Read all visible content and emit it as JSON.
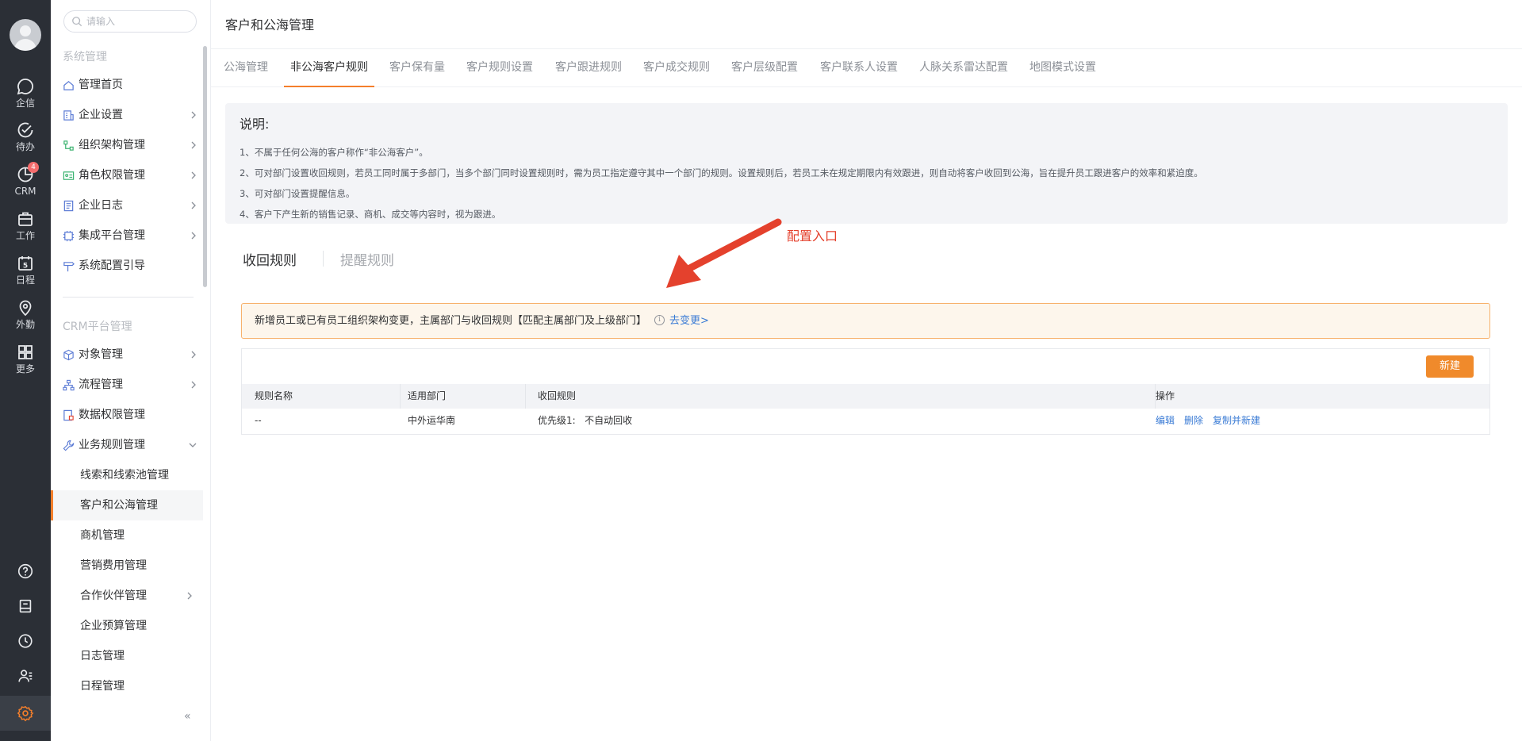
{
  "rail": {
    "items": [
      {
        "label": "企信",
        "icon": "chat-icon"
      },
      {
        "label": "待办",
        "icon": "check-circle-icon"
      },
      {
        "label": "CRM",
        "icon": "pie-chart-icon",
        "badge": "4"
      },
      {
        "label": "工作",
        "icon": "briefcase-icon"
      },
      {
        "label": "日程",
        "icon": "calendar-icon",
        "glyph": "5"
      },
      {
        "label": "外勤",
        "icon": "location-icon"
      },
      {
        "label": "更多",
        "icon": "grid-icon"
      }
    ],
    "bottom_icons": [
      "help-icon",
      "notebook-icon",
      "clock-icon",
      "contacts-icon",
      "settings-icon"
    ],
    "accent": "#f47f2b"
  },
  "sidebar": {
    "search_placeholder": "请输入",
    "group1_title": "系统管理",
    "group1_items": [
      {
        "label": "管理首页",
        "icon": "home-icon",
        "chevron": false
      },
      {
        "label": "企业设置",
        "icon": "building-icon",
        "chevron": true
      },
      {
        "label": "组织架构管理",
        "icon": "org-icon",
        "chevron": true
      },
      {
        "label": "角色权限管理",
        "icon": "id-card-icon",
        "chevron": true
      },
      {
        "label": "企业日志",
        "icon": "log-icon",
        "chevron": true
      },
      {
        "label": "集成平台管理",
        "icon": "chip-icon",
        "chevron": true
      },
      {
        "label": "系统配置引导",
        "icon": "signpost-icon",
        "chevron": false
      }
    ],
    "group2_title": "CRM平台管理",
    "group2_items": [
      {
        "label": "对象管理",
        "icon": "cube-icon",
        "chevron": true
      },
      {
        "label": "流程管理",
        "icon": "flow-icon",
        "chevron": true
      },
      {
        "label": "数据权限管理",
        "icon": "data-lock-icon",
        "chevron": false
      },
      {
        "label": "业务规则管理",
        "icon": "wrench-icon",
        "chevron": "down"
      }
    ],
    "sub_items": [
      {
        "label": "线索和线索池管理"
      },
      {
        "label": "客户和公海管理",
        "active": true
      },
      {
        "label": "商机管理"
      },
      {
        "label": "营销费用管理"
      },
      {
        "label": "合作伙伴管理",
        "chevron": true
      },
      {
        "label": "企业预算管理"
      },
      {
        "label": "日志管理"
      },
      {
        "label": "日程管理"
      }
    ],
    "collapse": "«"
  },
  "main": {
    "page_title": "客户和公海管理",
    "tabs": [
      {
        "label": "公海管理"
      },
      {
        "label": "非公海客户规则",
        "active": true
      },
      {
        "label": "客户保有量"
      },
      {
        "label": "客户规则设置"
      },
      {
        "label": "客户跟进规则"
      },
      {
        "label": "客户成交规则"
      },
      {
        "label": "客户层级配置"
      },
      {
        "label": "客户联系人设置"
      },
      {
        "label": "人脉关系雷达配置"
      },
      {
        "label": "地图模式设置"
      }
    ],
    "desc": {
      "title": "说明:",
      "lines": [
        "1、不属于任何公海的客户称作“非公海客户”。",
        "2、可对部门设置收回规则，若员工同时属于多部门，当多个部门同时设置规则时，需为员工指定遵守其中一个部门的规则。设置规则后，若员工未在规定期限内有效跟进，则自动将客户收回到公海，旨在提升员工跟进客户的效率和紧迫度。",
        "3、可对部门设置提醒信息。",
        "4、客户下产生新的销售记录、商机、成交等内容时，视为跟进。"
      ]
    },
    "annotation": "配置入口",
    "subtabs": [
      "收回规则",
      "提醒规则"
    ],
    "notice": {
      "text": "新增员工或已有员工组织架构变更，主属部门与收回规则【匹配主属部门及上级部门】",
      "info": "i",
      "link": "去变更>"
    },
    "new_button": "新建",
    "table": {
      "headers": [
        "规则名称",
        "适用部门",
        "收回规则",
        "操作"
      ],
      "rows": [
        {
          "name": "--",
          "dept": "中外运华南",
          "rule_label": "优先级1:",
          "rule_value": "不自动回收",
          "actions": [
            "编辑",
            "删除",
            "复制并新建"
          ]
        }
      ]
    }
  }
}
